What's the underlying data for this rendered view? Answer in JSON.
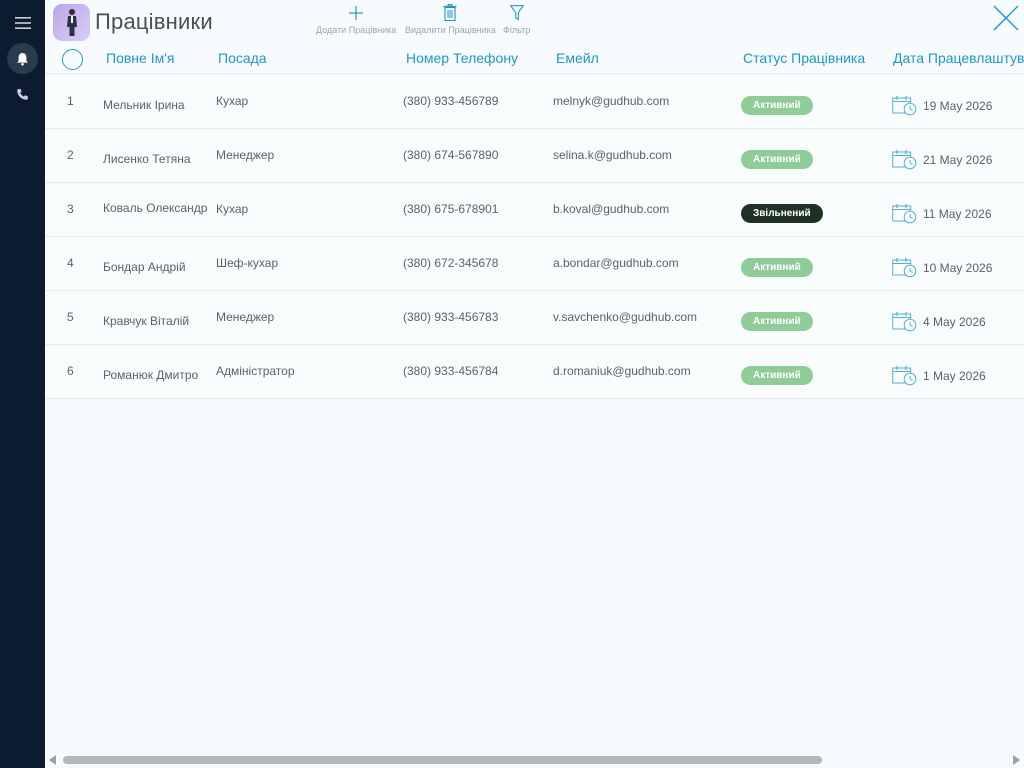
{
  "header": {
    "title": "Працівники",
    "tools": {
      "add_label": "Додати Працівника",
      "delete_label": "Видалити Працівника",
      "filter_label": "Фільтр"
    }
  },
  "sidebar": {
    "icons": [
      "menu-icon",
      "bell-icon",
      "phone-icon"
    ]
  },
  "table": {
    "columns": {
      "full_name": "Повне Ім'я",
      "position": "Посада",
      "phone": "Номер Телефону",
      "email": "Емейл",
      "status": "Статус Працівника",
      "hire_date": "Дата Працевлаштування"
    },
    "rows": [
      {
        "num": "1",
        "name": "Мельник Ірина",
        "position": "Кухар",
        "phone": "(380) 933-456789",
        "email": "melnyk@gudhub.com",
        "status": "Активний",
        "date": "19 May 2026"
      },
      {
        "num": "2",
        "name": "Лисенко Тетяна",
        "position": "Менеджер",
        "phone": "(380) 674-567890",
        "email": "selina.k@gudhub.com",
        "status": "Активний",
        "date": "21 May 2026"
      },
      {
        "num": "3",
        "name": "Коваль Олександр",
        "position": "Кухар",
        "phone": "(380) 675-678901",
        "email": "b.koval@gudhub.com",
        "status": "Звільнений",
        "date": "11 May 2026"
      },
      {
        "num": "4",
        "name": "Бондар Андрій",
        "position": "Шеф-кухар",
        "phone": "(380) 672-345678",
        "email": "a.bondar@gudhub.com",
        "status": "Активний",
        "date": "10 May 2026"
      },
      {
        "num": "5",
        "name": "Кравчук Віталій",
        "position": "Менеджер",
        "phone": "(380) 933-456783",
        "email": "v.savchenko@gudhub.com",
        "status": "Активний",
        "date": "4 May 2026"
      },
      {
        "num": "6",
        "name": "Романюк Дмитро",
        "position": "Адміністратор",
        "phone": "(380) 933-456784",
        "email": "d.romaniuk@gudhub.com",
        "status": "Активний",
        "date": "1 May 2026"
      }
    ]
  },
  "colors": {
    "accent": "#2197c7",
    "status_active": "#8fcc98",
    "status_fired": "#1f3124",
    "sidebar_bg": "#0d1b2e"
  }
}
